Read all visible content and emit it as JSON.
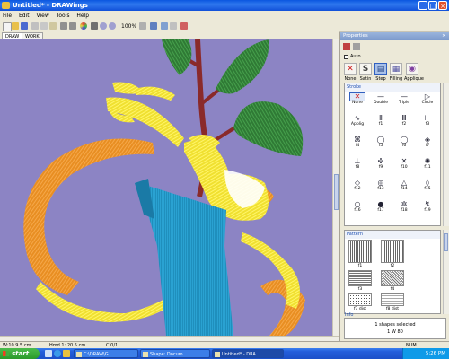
{
  "window": {
    "title": "Untitled* - DRAWings"
  },
  "menu": [
    "File",
    "Edit",
    "View",
    "Tools",
    "Help"
  ],
  "toolbar": {
    "zoom": "100%"
  },
  "doc_tabs": [
    "DRAW",
    "WORK"
  ],
  "properties": {
    "title": "Properties",
    "auto_label": "Auto",
    "stitch_types": [
      "None",
      "Satin",
      "Step",
      "Filling",
      "Applique"
    ],
    "stroke_section": "Stroke",
    "stroke_items": [
      {
        "glyph": "✕",
        "label": "None"
      },
      {
        "glyph": "—",
        "label": "Double"
      },
      {
        "glyph": "—",
        "label": "Triple"
      },
      {
        "glyph": "▷",
        "label": "Circle"
      },
      {
        "glyph": "∿",
        "label": "Applig"
      },
      {
        "glyph": "Ⅱ",
        "label": "f1"
      },
      {
        "glyph": "Ⅲ",
        "label": "f2"
      },
      {
        "glyph": "⊢",
        "label": "f3"
      },
      {
        "glyph": "⌘",
        "label": "f4"
      },
      {
        "glyph": "◯",
        "label": "f5"
      },
      {
        "glyph": "◯",
        "label": "f6"
      },
      {
        "glyph": "◈",
        "label": "f7"
      },
      {
        "glyph": "⊥",
        "label": "f8"
      },
      {
        "glyph": "✣",
        "label": "f9"
      },
      {
        "glyph": "✕",
        "label": "f10"
      },
      {
        "glyph": "✺",
        "label": "f11"
      },
      {
        "glyph": "◇",
        "label": "f12"
      },
      {
        "glyph": "◎",
        "label": "f13"
      },
      {
        "glyph": "△",
        "label": "f14"
      },
      {
        "glyph": "◊",
        "label": "f15"
      },
      {
        "glyph": "○",
        "label": "f16"
      },
      {
        "glyph": "●",
        "label": "f17"
      },
      {
        "glyph": "✲",
        "label": "f18"
      },
      {
        "glyph": "↯",
        "label": "f19"
      }
    ],
    "pattern_section": "Pattern",
    "pattern_labels": [
      "f1",
      "f2",
      "f3",
      "f4",
      "f5",
      "f6",
      "f7 dist",
      "f8 dist"
    ],
    "info_section": "Info",
    "info_line1": "1 shapes selected",
    "info_line2": "1 W 80"
  },
  "status": {
    "width": "W:10   9.5 cm",
    "height": "Hmd  1: 20.5 cm",
    "colors": "C:0/1",
    "mode": "NUM"
  },
  "taskbar": {
    "start": "start",
    "buttons": [
      "C:\\DRAW\\G ...",
      "Shape: Docum...",
      "Untitled* - DRA..."
    ],
    "clock": "5:26 PM"
  },
  "colors": {
    "canvas_bg": "#8c84c4",
    "stem": "#8a2a2a",
    "leaf": "#2f7a35",
    "vase": "#1f8fbd",
    "yellow": "#f2e535",
    "orange": "#e88e22"
  }
}
